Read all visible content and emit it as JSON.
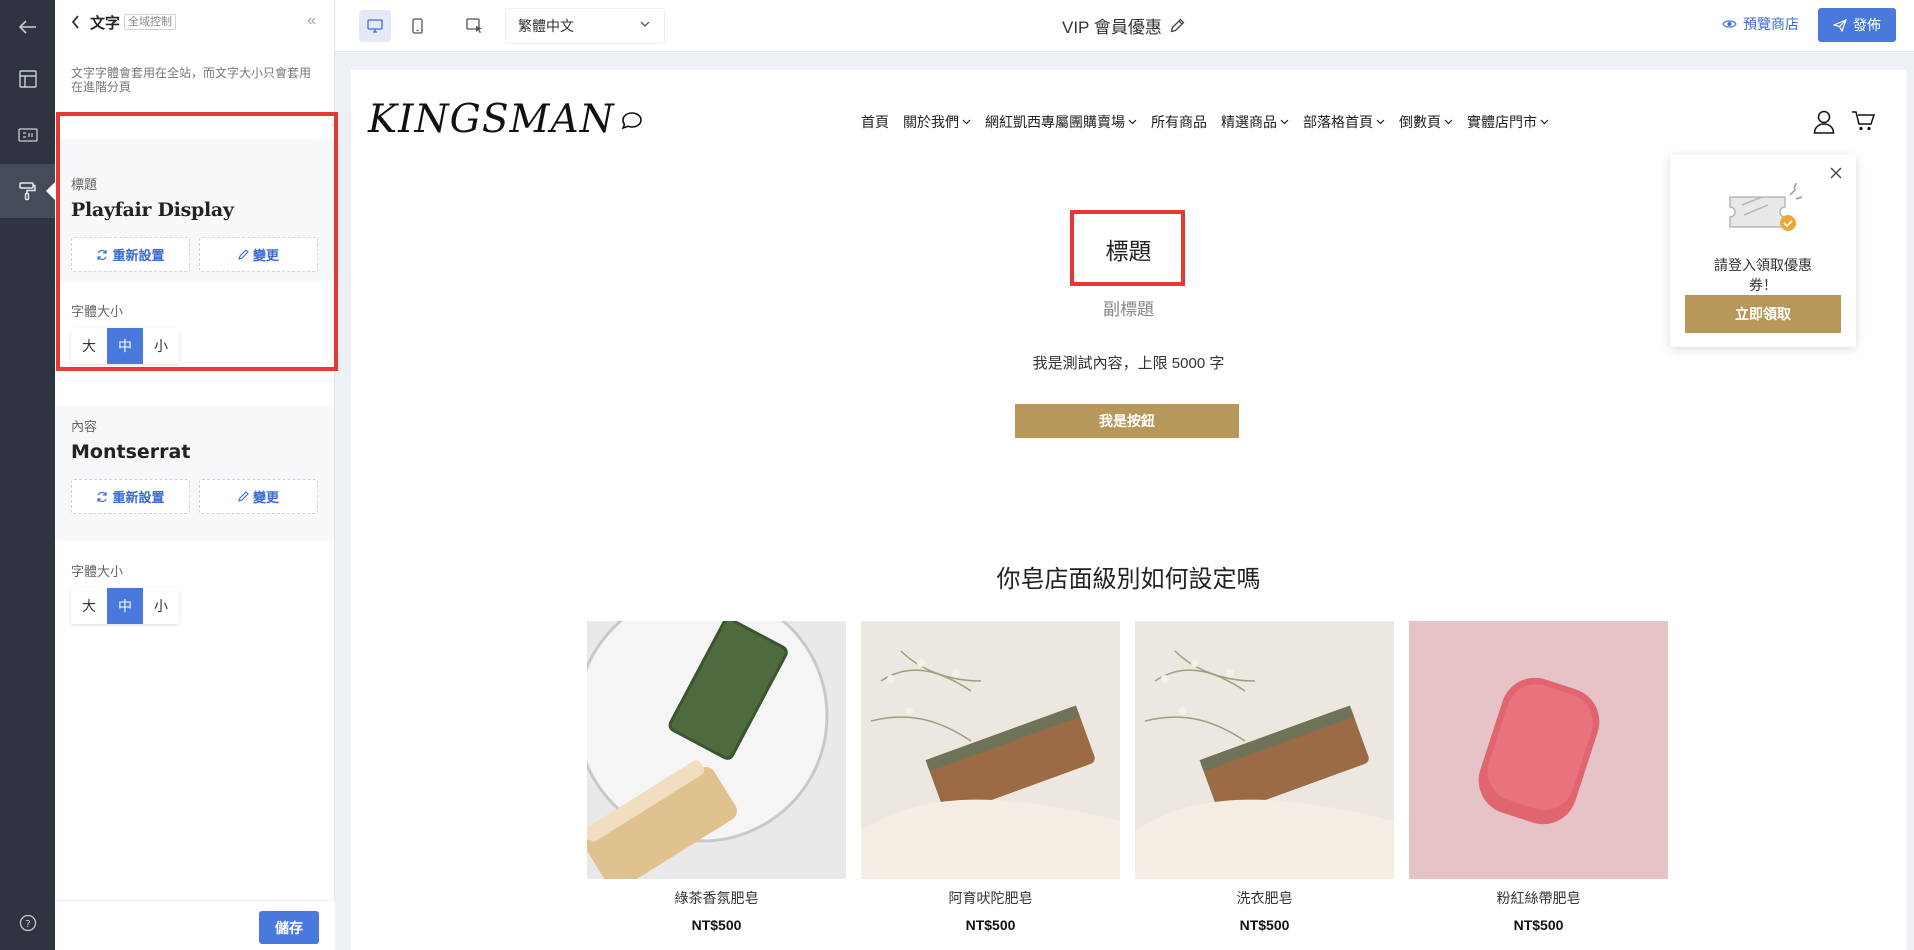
{
  "rail": {
    "icons": [
      "back-arrow-icon",
      "layout-icon",
      "seo-icon",
      "brush-icon",
      "help-icon"
    ]
  },
  "panel": {
    "title": "文字",
    "tag": "全域控制",
    "collapse": "«",
    "description": "文字字體會套用在全站，而文字大小只會套用在進階分頁",
    "heading_section": {
      "label": "標題",
      "font": "Playfair Display",
      "reset": "重新設置",
      "change": "變更"
    },
    "heading_size": {
      "label": "字體大小",
      "options": [
        "大",
        "中",
        "小"
      ],
      "selected": "中"
    },
    "body_section": {
      "label": "內容",
      "font": "Montserrat",
      "reset": "重新設置",
      "change": "變更"
    },
    "body_size": {
      "label": "字體大小",
      "options": [
        "大",
        "中",
        "小"
      ],
      "selected": "中"
    },
    "save": "儲存"
  },
  "topbar": {
    "language": "繁體中文",
    "page_title": "VIP 會員優惠",
    "preview": "預覽商店",
    "publish": "發佈"
  },
  "site": {
    "logo": "KINGSMAN",
    "nav": [
      {
        "label": "首頁",
        "dropdown": false
      },
      {
        "label": "關於我們",
        "dropdown": true
      },
      {
        "label": "網紅凱西專屬團購賣場",
        "dropdown": true
      },
      {
        "label": "所有商品",
        "dropdown": false
      },
      {
        "label": "精選商品",
        "dropdown": true
      },
      {
        "label": "部落格首頁",
        "dropdown": true
      },
      {
        "label": "倒數頁",
        "dropdown": true
      },
      {
        "label": "實體店門市",
        "dropdown": true
      }
    ],
    "hero": {
      "title": "標題",
      "subtitle": "副標題",
      "body": "我是測試內容，上限 5000 字",
      "button": "我是按鈕"
    },
    "section_title": "你皂店面級別如何設定嗎",
    "products": [
      {
        "name": "綠茶香氛肥皂",
        "price": "NT$500"
      },
      {
        "name": "阿育吠陀肥皂",
        "price": "NT$500"
      },
      {
        "name": "洗衣肥皂",
        "price": "NT$500"
      },
      {
        "name": "粉紅絲帶肥皂",
        "price": "NT$500"
      }
    ],
    "coupon": {
      "text": "請登入領取優惠券！",
      "button": "立即領取"
    }
  },
  "colors": {
    "accent": "#4a79dd",
    "gold": "#b8975a",
    "highlight": "#e53935",
    "rail": "#2f3440"
  }
}
